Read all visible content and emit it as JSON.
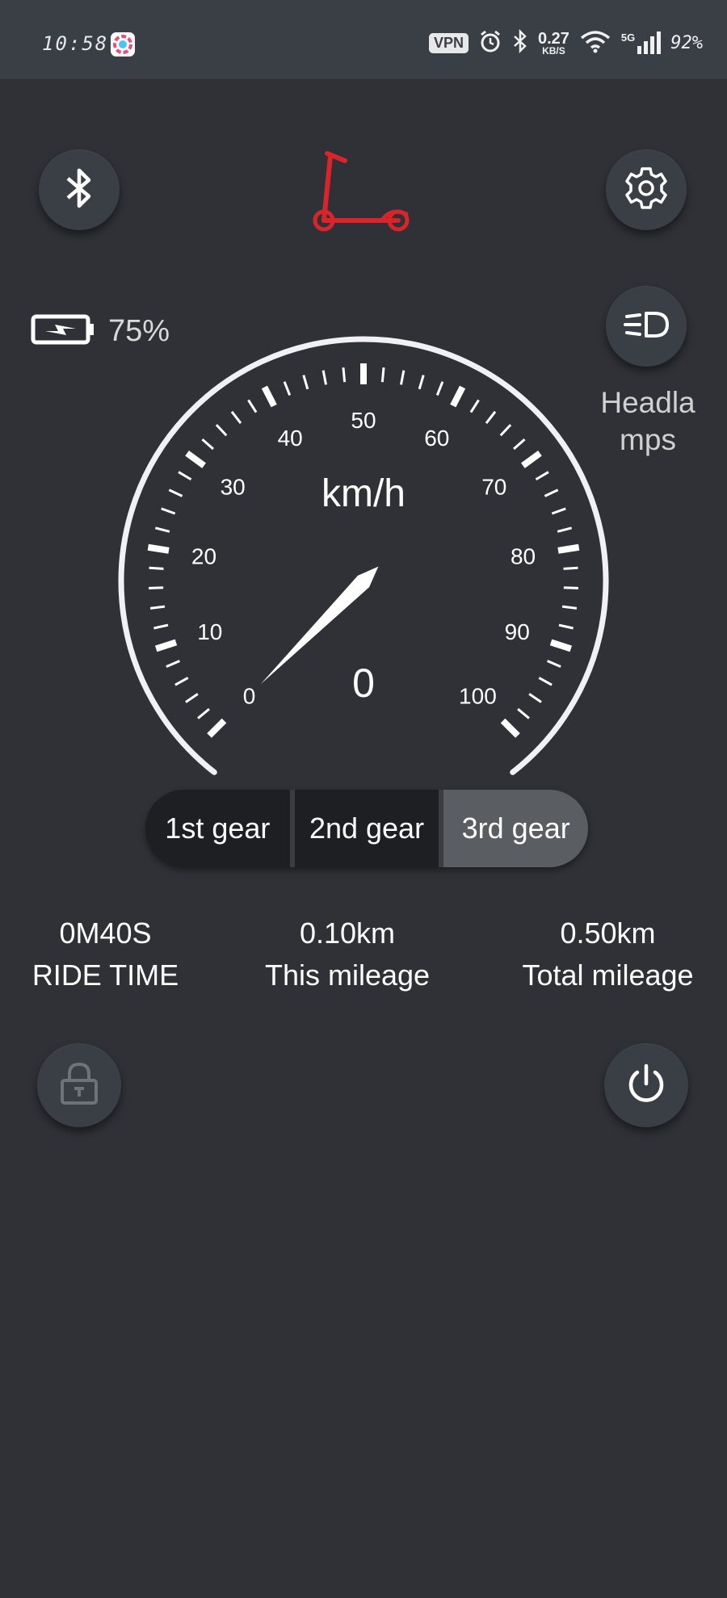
{
  "status_bar": {
    "time": "10:58",
    "vpn": "VPN",
    "net_speed": "0.27",
    "net_unit": "KB/S",
    "signal_type": "5G",
    "battery": "92%"
  },
  "header": {
    "bluetooth_icon": "bluetooth-icon",
    "logo_icon": "scooter-icon",
    "settings_icon": "gear-icon",
    "logo_color": "#d8242b"
  },
  "battery": {
    "percent": "75%"
  },
  "headlamp": {
    "label": "Headlamps",
    "icon": "headlamp-icon"
  },
  "speedometer": {
    "unit": "km/h",
    "speed": "0",
    "scale_labels": [
      "0",
      "10",
      "20",
      "30",
      "40",
      "50",
      "60",
      "70",
      "80",
      "90",
      "100"
    ],
    "min": 0,
    "max": 100
  },
  "gears": [
    {
      "label": "1st gear",
      "active": false
    },
    {
      "label": "2nd gear",
      "active": false
    },
    {
      "label": "3rd gear",
      "active": true
    }
  ],
  "stats": {
    "ride_time": {
      "value": "0M40S",
      "label": "RIDE TIME"
    },
    "this_mileage": {
      "value": "0.10km",
      "label": "This mileage"
    },
    "total_mileage": {
      "value": "0.50km",
      "label": "Total mileage"
    }
  },
  "footer": {
    "lock_icon": "lock-icon",
    "power_icon": "power-icon"
  }
}
